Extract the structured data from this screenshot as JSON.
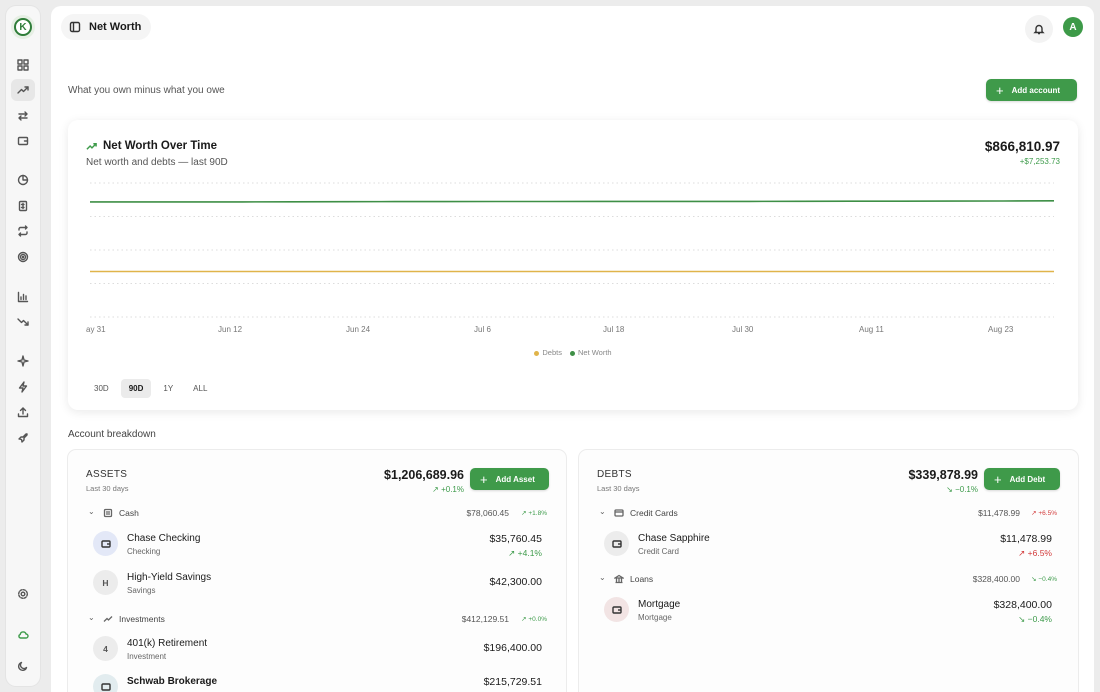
{
  "app": {
    "page_title": "Net Worth",
    "avatar_initial": "A"
  },
  "header": {
    "subtitle": "What you own minus what you owe",
    "add_account_label": "Add account"
  },
  "chart": {
    "title": "Net Worth Over Time",
    "subtitle": "Net worth and debts — last 90D",
    "total": "$866,810.97",
    "delta": "+$7,253.73",
    "legend": [
      "Debts",
      "Net Worth"
    ],
    "ranges": [
      "30D",
      "90D",
      "1Y",
      "ALL"
    ],
    "active_range": "90D"
  },
  "chart_data": {
    "type": "line",
    "x_ticks": [
      "ay 31",
      "Jun 12",
      "Jun 24",
      "Jul 6",
      "Jul 18",
      "Jul 30",
      "Aug 11",
      "Aug 23"
    ],
    "series": [
      {
        "name": "Net Worth",
        "color": "#3e8f46",
        "values": [
          859000,
          859000,
          859200,
          859200,
          859500,
          860500,
          861000,
          861000,
          862000,
          862200,
          862500,
          862500,
          863000,
          863000,
          863500,
          864000,
          864000,
          865000,
          866000,
          866810.97
        ]
      },
      {
        "name": "Debts",
        "color": "#e0b44a",
        "values": [
          339900,
          339900,
          339900,
          339900,
          339900,
          339900,
          339900,
          339900,
          339900,
          339900,
          339900,
          339900,
          339900,
          339900,
          339900,
          339900,
          339900,
          339900,
          339900,
          339878.99
        ]
      }
    ],
    "ylim": [
      0,
      1000000
    ],
    "grid": true,
    "legend_position": "bottom"
  },
  "breakdown": {
    "label": "Account breakdown"
  },
  "assets": {
    "heading": "ASSETS",
    "period": "Last 30 days",
    "total": "$1,206,689.96",
    "delta": "↗ +0.1%",
    "add_label": "Add Asset",
    "groups": [
      {
        "name": "Cash",
        "amount": "$78,060.45",
        "delta": "↗ +1.8%"
      },
      {
        "name": "Investments",
        "amount": "$412,129.51",
        "delta": "↗ +0.0%"
      }
    ],
    "accounts": [
      {
        "name": "Chase Checking",
        "type": "Checking",
        "amount": "$35,760.45",
        "delta": "↗ +4.1%"
      },
      {
        "name": "High-Yield Savings",
        "type": "Savings",
        "amount": "$42,300.00",
        "initial": "H"
      },
      {
        "name": "401(k) Retirement",
        "type": "Investment",
        "amount": "$196,400.00",
        "initial": "4"
      },
      {
        "name": "Schwab Brokerage",
        "amount": "$215,729.51"
      }
    ]
  },
  "debts": {
    "heading": "DEBTS",
    "period": "Last 30 days",
    "total": "$339,878.99",
    "delta": "↘ −0.1%",
    "add_label": "Add Debt",
    "groups": [
      {
        "name": "Credit Cards",
        "amount": "$11,478.99",
        "delta": "↗ +6.5%"
      },
      {
        "name": "Loans",
        "amount": "$328,400.00",
        "delta": "↘ −0.4%"
      }
    ],
    "accounts": [
      {
        "name": "Chase Sapphire",
        "type": "Credit Card",
        "amount": "$11,478.99",
        "delta": "↗ +6.5%"
      },
      {
        "name": "Mortgage",
        "type": "Mortgage",
        "amount": "$328,400.00",
        "delta": "↘ −0.4%"
      }
    ]
  }
}
